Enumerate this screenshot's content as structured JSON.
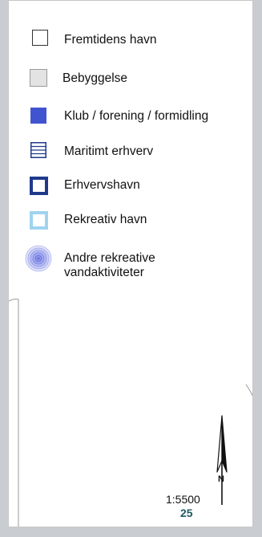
{
  "legend": {
    "items": [
      {
        "key": "future_harbor",
        "label": "Fremtidens havn",
        "icon": "hollow-square-icon",
        "fill": "#ffffff",
        "border": "#333333"
      },
      {
        "key": "buildings",
        "label": "Bebyggelse",
        "icon": "gray-square-icon",
        "fill": "#e3e3e3",
        "border": "#9a9a9a"
      },
      {
        "key": "club",
        "label": "Klub / forening / formidling",
        "icon": "blue-square-icon",
        "fill": "#4054d0",
        "border": "#4054d0"
      },
      {
        "key": "maritime",
        "label": "Maritimt erhverv",
        "icon": "striped-square-icon",
        "fill": "#ffffff",
        "border": "#1f3a8c"
      },
      {
        "key": "commercial",
        "label": "Erhvervshavn",
        "icon": "navy-frame-icon",
        "fill": "#ffffff",
        "border": "#1f3a8c"
      },
      {
        "key": "recreational",
        "label": "Rekreativ havn",
        "icon": "lightblue-frame-icon",
        "fill": "#ffffff",
        "border": "#9fd3f0"
      },
      {
        "key": "water_activities",
        "label": "Andre rekreative\nvandaktiviteter",
        "icon": "concentric-circles-icon",
        "fill": "#9fa6f0",
        "border": "#6a72d8"
      }
    ]
  },
  "scale": "1:5500",
  "page_number": "25",
  "north": "N"
}
